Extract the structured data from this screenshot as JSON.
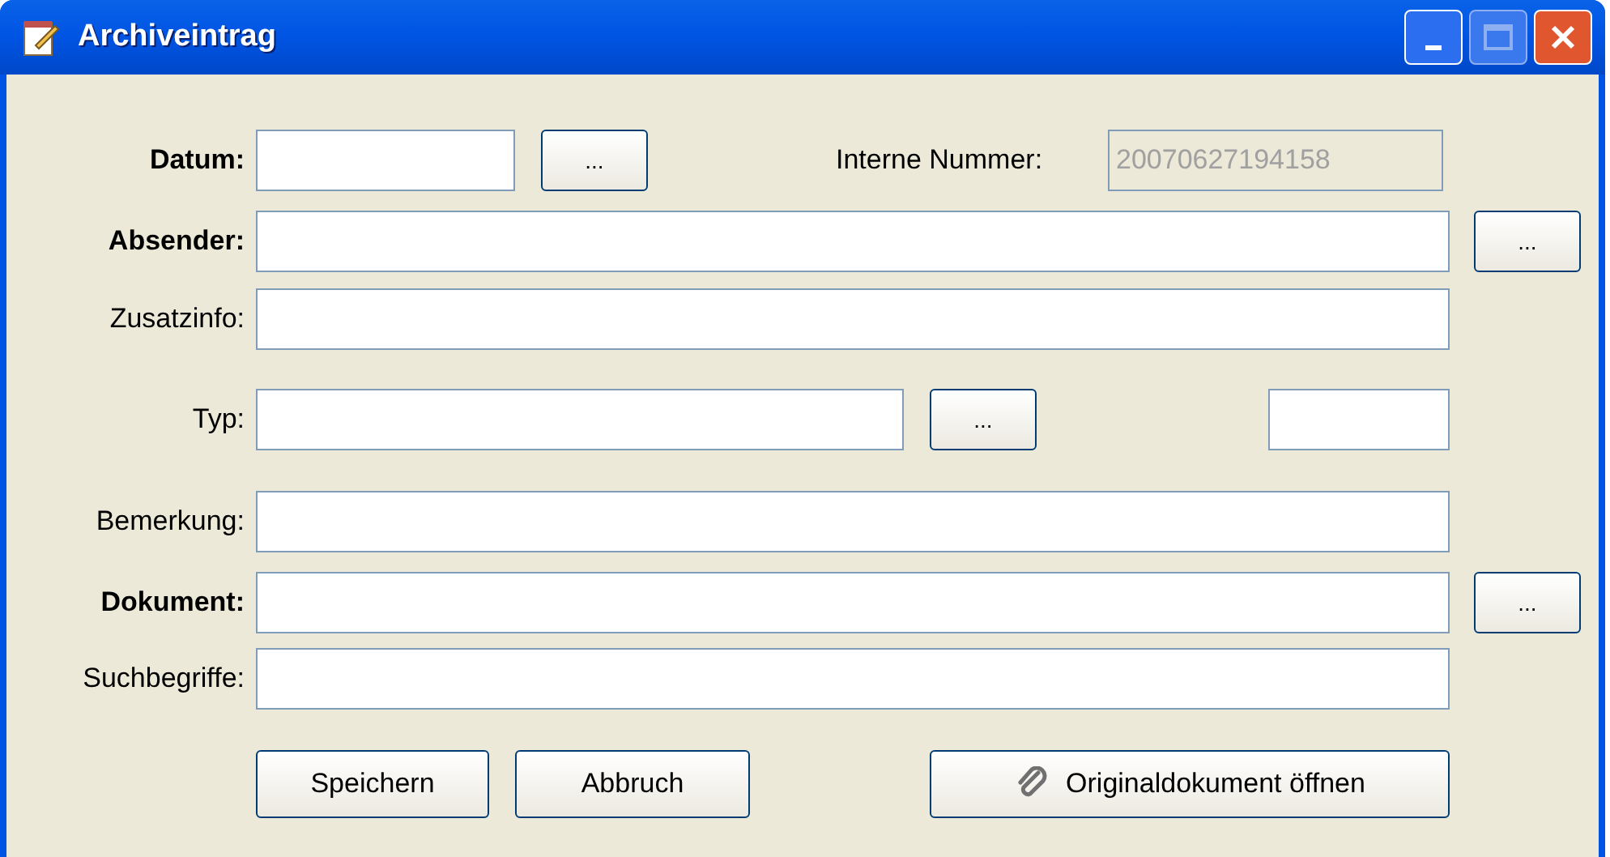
{
  "window": {
    "title": "Archiveintrag"
  },
  "rows": [
    {
      "label": "Datum:",
      "required": true,
      "browse": "..."
    },
    {
      "label": "Absender:",
      "required": true,
      "browse": "..."
    },
    {
      "label": "Zusatzinfo:",
      "required": false
    },
    {
      "label": "Typ:",
      "required": false,
      "browse": "..."
    },
    {
      "label": "Bemerkung:",
      "required": false
    },
    {
      "label": "Dokument:",
      "required": true,
      "browse": "..."
    },
    {
      "label": "Suchbegriffe:",
      "required": false
    }
  ],
  "internal_number": {
    "label": "Interne Nummer:",
    "value": "20070627194158",
    "disabled": true
  },
  "buttons": [
    {
      "label": "Speichern",
      "kind": "plain"
    },
    {
      "label": "Abbruch",
      "kind": "plain"
    },
    {
      "label": "Originaldokument öffnen",
      "kind": "attachment"
    }
  ]
}
